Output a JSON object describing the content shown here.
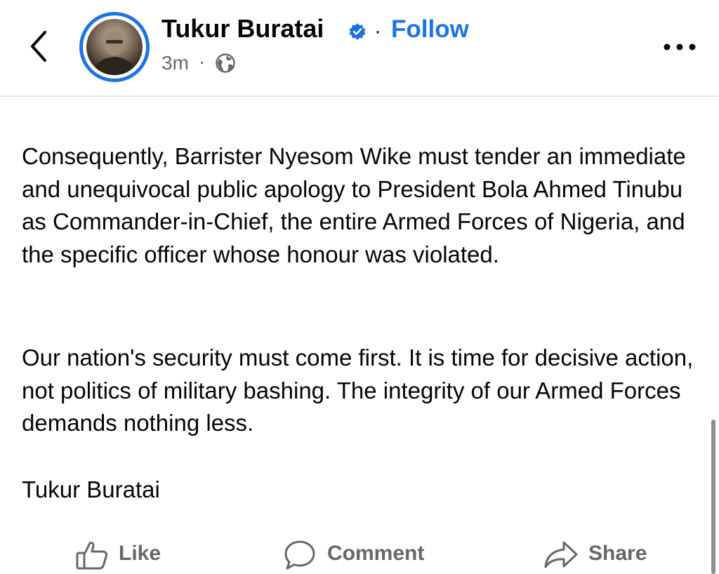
{
  "header": {
    "author_name": "Tukur Buratai",
    "separator": "·",
    "follow_label": "Follow",
    "timestamp": "3m",
    "timestamp_separator": "·",
    "privacy_icon": "globe-icon",
    "verified_icon": "verified-badge-icon",
    "back_icon": "chevron-left-icon",
    "more_icon": "more-horizontal-icon"
  },
  "post": {
    "paragraphs": [
      "Consequently, Barrister Nyesom Wike must tender an immediate and unequivocal public apology to President Bola Ahmed Tinubu as Commander-in-Chief, the entire Armed Forces of Nigeria, and the specific officer whose honour was violated.",
      "Our nation's security must come first. It is time for decisive action, not politics of military bashing. The integrity of our Armed Forces demands nothing less."
    ],
    "signature": "Tukur Buratai"
  },
  "actions": {
    "like_label": "Like",
    "comment_label": "Comment",
    "share_label": "Share",
    "like_icon": "thumbs-up-icon",
    "comment_icon": "comment-bubble-icon",
    "share_icon": "share-arrow-icon"
  },
  "colors": {
    "accent": "#1b74e4",
    "text": "#050505",
    "muted": "#65676b"
  }
}
